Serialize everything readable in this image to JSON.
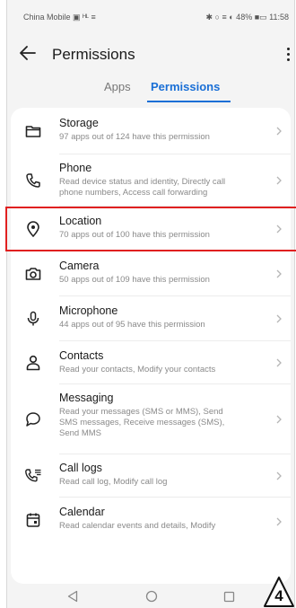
{
  "status_bar": {
    "carrier": "China Mobile ▣ ᴴᴸ ≡",
    "indicators": "✱ ○ ≡ ◐ 48% ■▭ 11:58"
  },
  "header": {
    "back_icon": "arrow-left-icon",
    "title": "Permissions",
    "more_icon": "more-vertical-icon"
  },
  "tabs": [
    {
      "label": "Apps",
      "selected": false
    },
    {
      "label": "Permissions",
      "selected": true
    }
  ],
  "permissions": [
    {
      "icon": "folder-icon",
      "name": "Storage",
      "desc": [
        "97 apps out of 124 have this permission"
      ]
    },
    {
      "icon": "phone-icon",
      "name": "Phone",
      "desc": [
        "Read device status and identity, Directly call",
        "phone numbers, Access call forwarding"
      ]
    },
    {
      "icon": "location-pin-icon",
      "name": "Location",
      "desc": [
        "70 apps out of 100 have this permission"
      ]
    },
    {
      "icon": "camera-icon",
      "name": "Camera",
      "desc": [
        "50 apps out of 109 have this permission"
      ]
    },
    {
      "icon": "microphone-icon",
      "name": "Microphone",
      "desc": [
        "44 apps out of 95 have this permission"
      ]
    },
    {
      "icon": "person-icon",
      "name": "Contacts",
      "desc": [
        "Read your contacts, Modify your contacts"
      ]
    },
    {
      "icon": "chat-bubble-icon",
      "name": "Messaging",
      "desc": [
        "Read your messages (SMS or MMS), Send",
        "SMS messages, Receive messages (SMS),",
        "Send MMS"
      ]
    },
    {
      "icon": "call-log-icon",
      "name": "Call logs",
      "desc": [
        "Read call log, Modify call log"
      ]
    },
    {
      "icon": "calendar-icon",
      "name": "Calendar",
      "desc": [
        "Read calendar events and details, Modify"
      ]
    }
  ],
  "highlighted_item": "Location",
  "step_badge": "4",
  "colors": {
    "accent": "#1a6fd6",
    "highlight_border": "#e02020",
    "background": "#f4f4f4",
    "card": "#ffffff"
  }
}
